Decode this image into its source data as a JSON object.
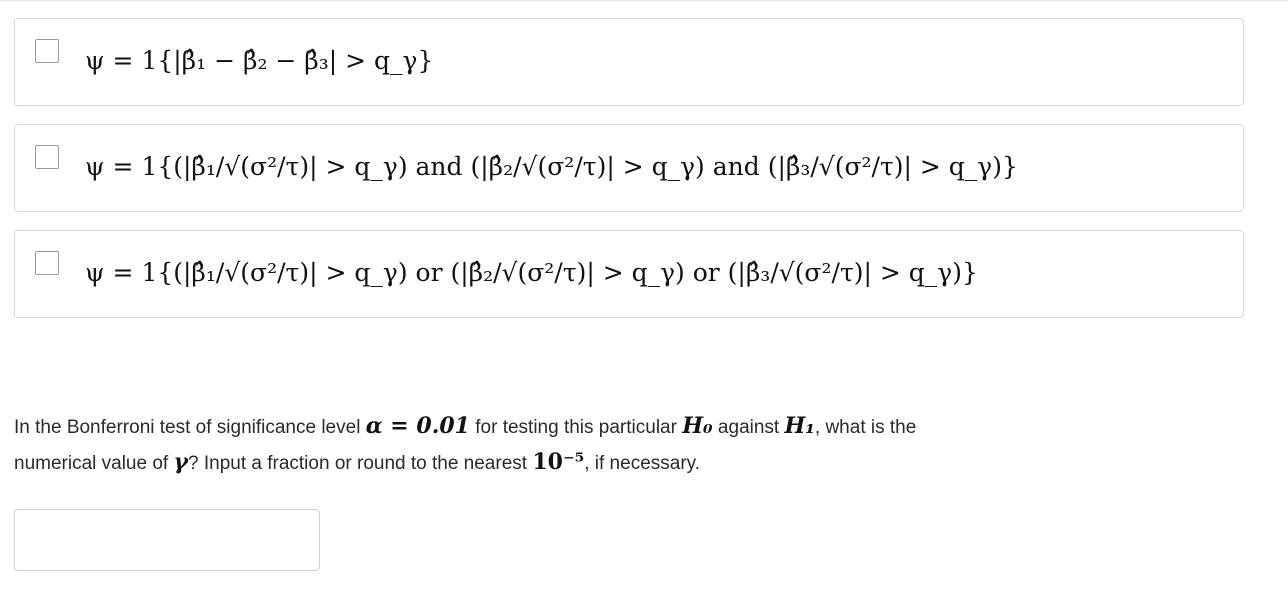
{
  "options": [
    {
      "formula": "ψ = 1{|β̂₁ − β̂₂ − β̂₃| > q_γ}"
    },
    {
      "formula": "ψ = 1{(|β̂₁/√(σ²/τ)| > q_γ) and (|β̂₂/√(σ²/τ)| > q_γ) and (|β̂₃/√(σ²/τ)| > q_γ)}"
    },
    {
      "formula": "ψ = 1{(|β̂₁/√(σ²/τ)| > q_γ) or (|β̂₂/√(σ²/τ)| > q_γ) or (|β̂₃/√(σ²/τ)| > q_γ)}"
    }
  ],
  "question": {
    "part1": "In the Bonferroni test of significance level ",
    "alpha": "α = 0.01",
    "part2": " for testing this particular ",
    "h0": "H₀",
    "part3": " against ",
    "h1": "H₁",
    "part4": ", what is the",
    "part5": "numerical value of ",
    "gamma": "γ",
    "part6": "? Input a fraction or round to the nearest ",
    "ten": "10⁻⁵",
    "part7": ", if necessary."
  },
  "answer": {
    "value": "",
    "placeholder": ""
  }
}
